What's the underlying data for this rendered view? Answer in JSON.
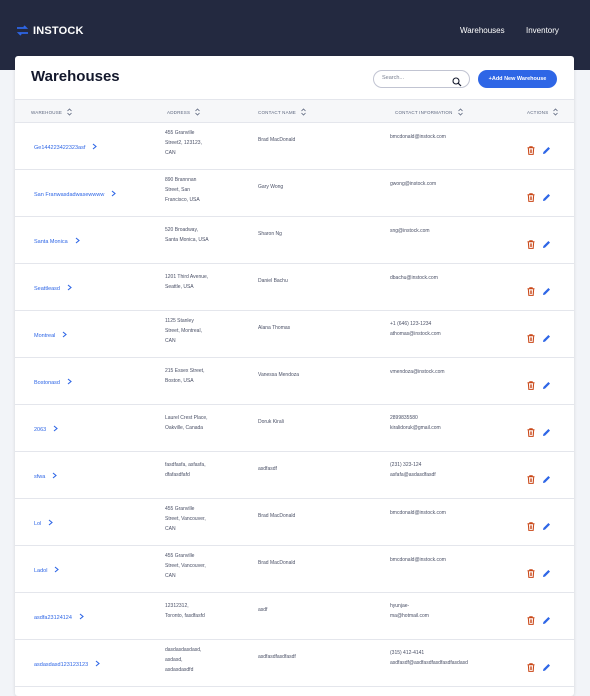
{
  "header": {
    "logo_text": "INSTOCK",
    "nav": [
      "Warehouses",
      "Inventory"
    ]
  },
  "page": {
    "title": "Warehouses",
    "search_placeholder": "Search...",
    "add_button": "+Add New Warehouse"
  },
  "table": {
    "columns": [
      "WAREHOUSE",
      "ADDRESS",
      "CONTACT NAME",
      "CONTACT INFORMATION",
      "ACTIONS"
    ],
    "rows": [
      {
        "warehouse": "Ge144223422323asf",
        "address": [
          "455 Granville",
          "Street2, 123123,",
          "CAN"
        ],
        "contact": "Brad MacDonald",
        "info": [
          "bmcdonald@instock.com"
        ]
      },
      {
        "warehouse": "San Franwasdadwasewwww",
        "address": [
          "890 Brannnan",
          "Street, San",
          "Francisco, USA"
        ],
        "contact": "Gary Wong",
        "info": [
          "gwong@instock.com"
        ]
      },
      {
        "warehouse": "Santa Monica",
        "address": [
          "520 Broadway,",
          "Santa Monica, USA"
        ],
        "contact": "Sharon Ng",
        "info": [
          "sng@instock.com"
        ]
      },
      {
        "warehouse": "Seattleasd",
        "address": [
          "1201 Third Avenue,",
          "Seattle, USA"
        ],
        "contact": "Daniel Bachu",
        "info": [
          "dbachu@instock.com"
        ]
      },
      {
        "warehouse": "Montreal",
        "address": [
          "1125 Stanley",
          "Street, Montreal,",
          "CAN"
        ],
        "contact": "Alana Thomas",
        "info": [
          "+1 (646) 123-1234",
          "athomas@instock.com"
        ]
      },
      {
        "warehouse": "Bostonasd",
        "address": [
          "215 Essex Street,",
          "Boston, USA"
        ],
        "contact": "Vanessa Mendoza",
        "info": [
          "vmendoza@instock.com"
        ]
      },
      {
        "warehouse": "2063",
        "address": [
          "Laurel Crest Place,",
          "Oakville, Canada"
        ],
        "contact": "Doruk Kirali",
        "info": [
          "2899835580",
          "kiralidoruk@gmail.com"
        ]
      },
      {
        "warehouse": "sfwa",
        "address": [
          "fasdfasfa, asfasfa,",
          "dfafasdfafd"
        ],
        "contact": "asdfasdf",
        "info": [
          "(231) 323-124",
          "asfafa@asdasdfasdf"
        ]
      },
      {
        "warehouse": "Lol",
        "address": [
          "455 Granville",
          "Street, Vancouver,",
          "CAN"
        ],
        "contact": "Brad MacDonald",
        "info": [
          "bmcdonald@instock.com"
        ]
      },
      {
        "warehouse": "Ladol",
        "address": [
          "455 Granville",
          "Street, Vancouver,",
          "CAN"
        ],
        "contact": "Brad MacDonald",
        "info": [
          "bmcdonald@instock.com"
        ]
      },
      {
        "warehouse": "asdfa23124124",
        "address": [
          "12312312,",
          "Toronto, fasdfasfd"
        ],
        "contact": "asdf",
        "info": [
          "hyunjae-",
          "ma@hotmail.com"
        ]
      },
      {
        "warehouse": "asdasdasd123123123",
        "address": [
          "dasdasdasdasd,",
          "asdasd,",
          "asdasdasdfd"
        ],
        "contact": "asdfasdfasdfasdf",
        "info": [
          "(315) 412-4141",
          "asdfasdf@asdfasdfasdfasdfasdasd"
        ]
      }
    ]
  },
  "colors": {
    "header_bg": "#232940",
    "accent": "#2e66e6",
    "delete": "#c94515"
  },
  "icons": {
    "logo": "swap-arrows-icon",
    "search": "search-icon",
    "sort": "sort-icon",
    "chevron": "chevron-right-icon",
    "delete": "trash-icon",
    "edit": "pencil-icon"
  }
}
